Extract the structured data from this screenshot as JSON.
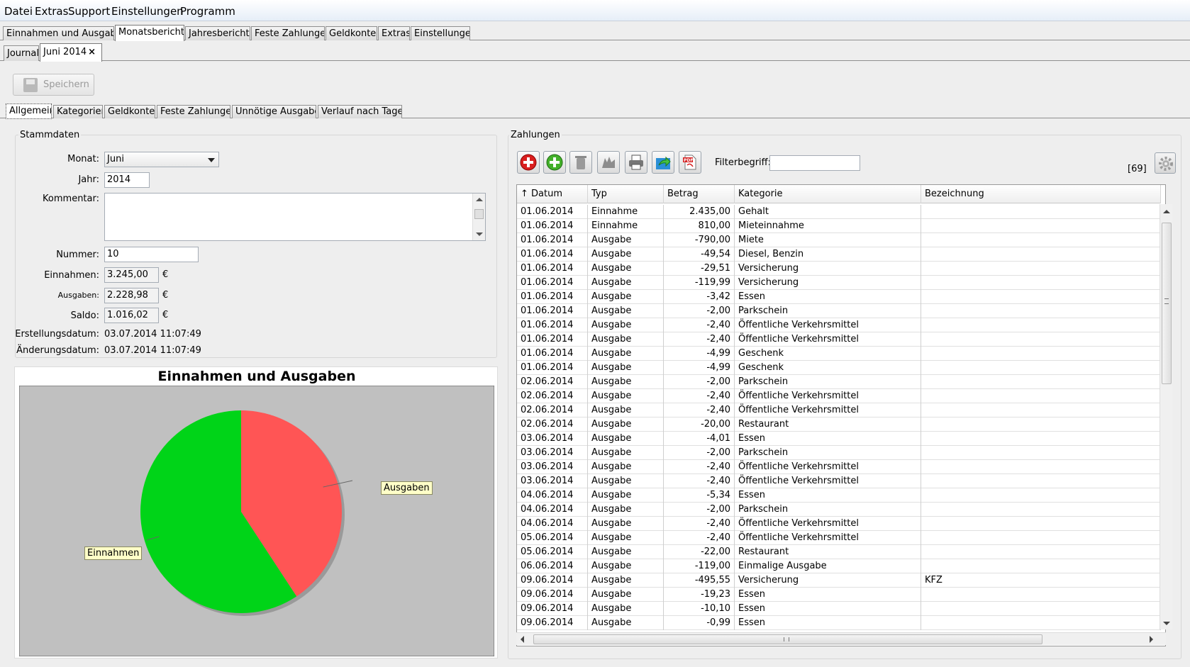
{
  "menubar": [
    "Datei",
    "Extras",
    "Support",
    "Einstellungen",
    "Programm"
  ],
  "main_tabs": [
    {
      "label": "Einnahmen und Ausgaben",
      "active": false
    },
    {
      "label": "Monatsberichte",
      "active": true
    },
    {
      "label": "Jahresberichte",
      "active": false
    },
    {
      "label": "Feste Zahlungen",
      "active": false
    },
    {
      "label": "Geldkonten",
      "active": false
    },
    {
      "label": "Extras",
      "active": false
    },
    {
      "label": "Einstellungen",
      "active": false
    }
  ],
  "doc_tabs": [
    {
      "label": "Journal",
      "active": false
    },
    {
      "label": "Juni 2014",
      "active": true,
      "close": "×"
    }
  ],
  "save_button": {
    "label": "Speichern"
  },
  "sub_tabs": [
    {
      "label": "Allgemein",
      "active": true
    },
    {
      "label": "Kategorien",
      "active": false
    },
    {
      "label": "Geldkonten",
      "active": false
    },
    {
      "label": "Feste Zahlungen",
      "active": false
    },
    {
      "label": "Unnötige Ausgaben",
      "active": false
    },
    {
      "label": "Verlauf nach Tagen",
      "active": false
    }
  ],
  "stammdaten": {
    "title": "Stammdaten",
    "monat_label": "Monat:",
    "monat_value": "Juni",
    "jahr_label": "Jahr:",
    "jahr_value": "2014",
    "kommentar_label": "Kommentar:",
    "kommentar_value": "",
    "nummer_label": "Nummer:",
    "nummer_value": "10",
    "einnahmen_label": "Einnahmen:",
    "einnahmen_value": "3.245,00",
    "ausgaben_label": "Ausgaben:",
    "ausgaben_value": "2.228,98",
    "saldo_label": "Saldo:",
    "saldo_value": "1.016,02",
    "currency": "€",
    "erstellung_label": "Erstellungsdatum:",
    "erstellung_value": "03.07.2014  11:07:49",
    "aenderung_label": "Änderungsdatum:",
    "aenderung_value": "03.07.2014  11:07:49"
  },
  "chart_data": {
    "type": "pie",
    "title": "Einnahmen und Ausgaben",
    "slices": [
      {
        "label": "Ausgaben",
        "value": 2228.98,
        "color": "#ff5555"
      },
      {
        "label": "Einnahmen",
        "value": 3245.0,
        "color": "#00d418"
      }
    ],
    "background": "#c0c0c0"
  },
  "zahlungen": {
    "title": "Zahlungen",
    "filter_label": "Filterbegriff:",
    "filter_value": "",
    "count": "[69]",
    "toolbar_icons": [
      "remove-icon",
      "add-icon",
      "trash-icon",
      "clear-icon",
      "print-icon",
      "export-icon",
      "pdf-icon"
    ],
    "columns": [
      "↑ Datum",
      "Typ",
      "Betrag",
      "Kategorie",
      "Bezeichnung"
    ],
    "rows": [
      [
        "01.06.2014",
        "Einnahme",
        "2.435,00",
        "Gehalt",
        ""
      ],
      [
        "01.06.2014",
        "Einnahme",
        "810,00",
        "Mieteinnahme",
        ""
      ],
      [
        "01.06.2014",
        "Ausgabe",
        "-790,00",
        "Miete",
        ""
      ],
      [
        "01.06.2014",
        "Ausgabe",
        "-49,54",
        "Diesel, Benzin",
        ""
      ],
      [
        "01.06.2014",
        "Ausgabe",
        "-29,51",
        "Versicherung",
        ""
      ],
      [
        "01.06.2014",
        "Ausgabe",
        "-119,99",
        "Versicherung",
        ""
      ],
      [
        "01.06.2014",
        "Ausgabe",
        "-3,42",
        "Essen",
        ""
      ],
      [
        "01.06.2014",
        "Ausgabe",
        "-2,00",
        "Parkschein",
        ""
      ],
      [
        "01.06.2014",
        "Ausgabe",
        "-2,40",
        "Öffentliche Verkehrsmittel",
        ""
      ],
      [
        "01.06.2014",
        "Ausgabe",
        "-2,40",
        "Öffentliche Verkehrsmittel",
        ""
      ],
      [
        "01.06.2014",
        "Ausgabe",
        "-4,99",
        "Geschenk",
        ""
      ],
      [
        "01.06.2014",
        "Ausgabe",
        "-4,99",
        "Geschenk",
        ""
      ],
      [
        "02.06.2014",
        "Ausgabe",
        "-2,00",
        "Parkschein",
        ""
      ],
      [
        "02.06.2014",
        "Ausgabe",
        "-2,40",
        "Öffentliche Verkehrsmittel",
        ""
      ],
      [
        "02.06.2014",
        "Ausgabe",
        "-2,40",
        "Öffentliche Verkehrsmittel",
        ""
      ],
      [
        "02.06.2014",
        "Ausgabe",
        "-20,00",
        "Restaurant",
        ""
      ],
      [
        "03.06.2014",
        "Ausgabe",
        "-4,01",
        "Essen",
        ""
      ],
      [
        "03.06.2014",
        "Ausgabe",
        "-2,00",
        "Parkschein",
        ""
      ],
      [
        "03.06.2014",
        "Ausgabe",
        "-2,40",
        "Öffentliche Verkehrsmittel",
        ""
      ],
      [
        "03.06.2014",
        "Ausgabe",
        "-2,40",
        "Öffentliche Verkehrsmittel",
        ""
      ],
      [
        "04.06.2014",
        "Ausgabe",
        "-5,34",
        "Essen",
        ""
      ],
      [
        "04.06.2014",
        "Ausgabe",
        "-2,00",
        "Parkschein",
        ""
      ],
      [
        "04.06.2014",
        "Ausgabe",
        "-2,40",
        "Öffentliche Verkehrsmittel",
        ""
      ],
      [
        "05.06.2014",
        "Ausgabe",
        "-2,40",
        "Öffentliche Verkehrsmittel",
        ""
      ],
      [
        "05.06.2014",
        "Ausgabe",
        "-22,00",
        "Restaurant",
        ""
      ],
      [
        "06.06.2014",
        "Ausgabe",
        "-119,00",
        "Einmalige Ausgabe",
        ""
      ],
      [
        "09.06.2014",
        "Ausgabe",
        "-495,55",
        "Versicherung",
        "KFZ"
      ],
      [
        "09.06.2014",
        "Ausgabe",
        "-19,23",
        "Essen",
        ""
      ],
      [
        "09.06.2014",
        "Ausgabe",
        "-10,10",
        "Essen",
        ""
      ],
      [
        "09.06.2014",
        "Ausgabe",
        "-0,99",
        "Essen",
        ""
      ]
    ]
  }
}
